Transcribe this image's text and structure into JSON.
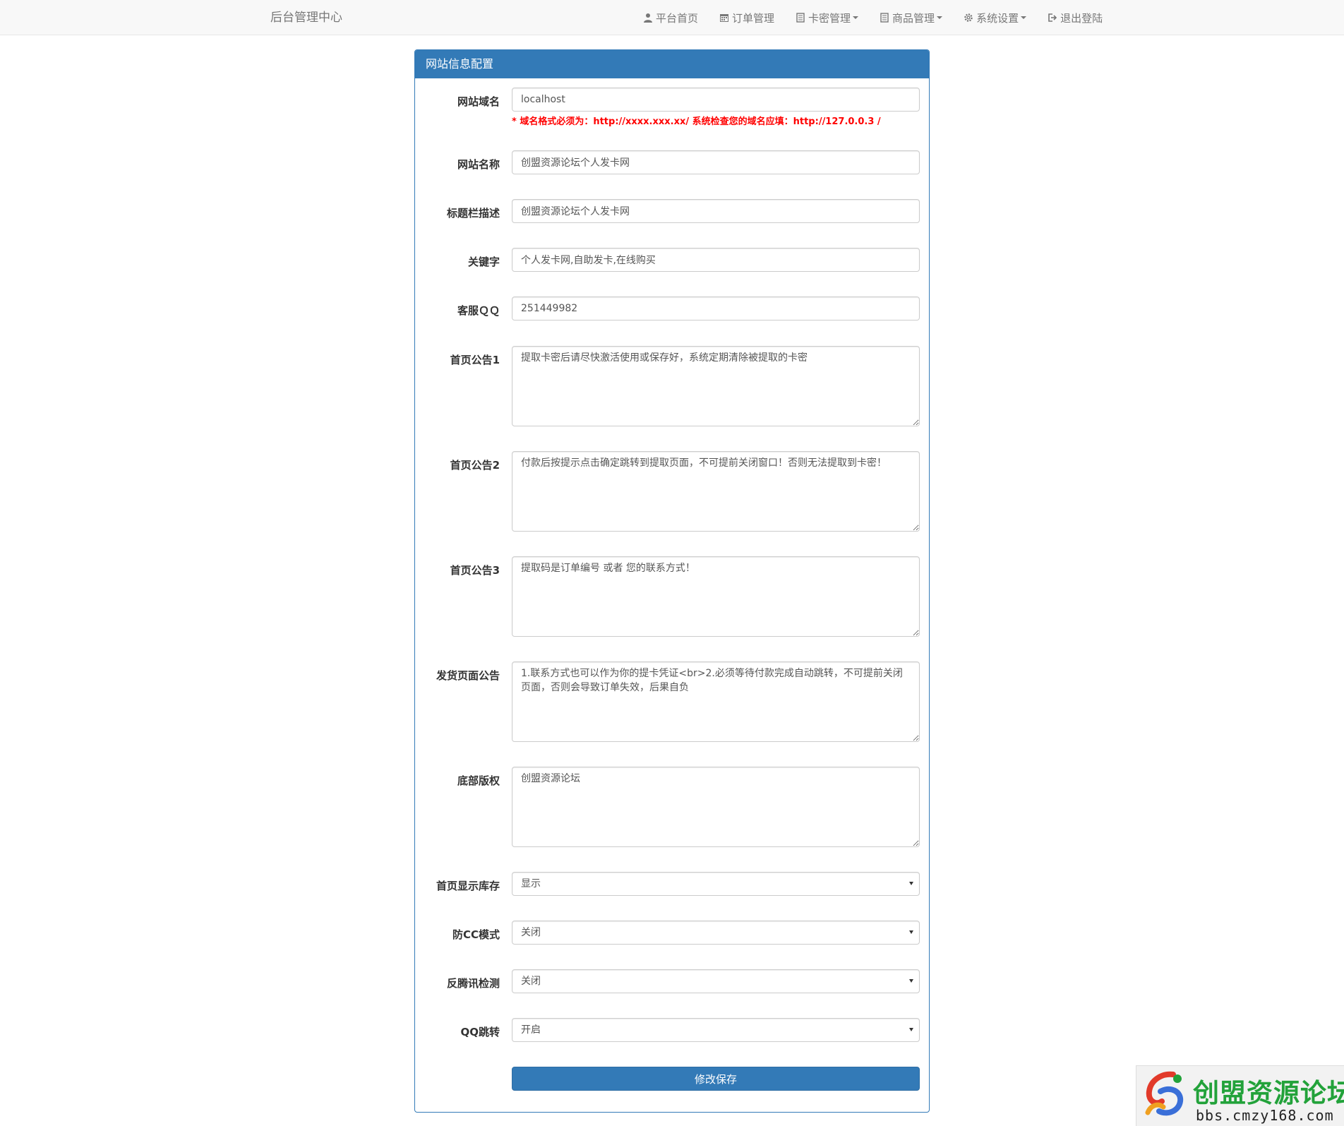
{
  "navbar": {
    "brand": "后台管理中心",
    "links": [
      {
        "label": "平台首页",
        "icon": "user-icon",
        "dropdown": false
      },
      {
        "label": "订单管理",
        "icon": "calendar-icon",
        "dropdown": false
      },
      {
        "label": "卡密管理",
        "icon": "list-icon",
        "dropdown": true
      },
      {
        "label": "商品管理",
        "icon": "list-icon",
        "dropdown": true
      },
      {
        "label": "系统设置",
        "icon": "gear-icon",
        "dropdown": true
      },
      {
        "label": "退出登陆",
        "icon": "logout-icon",
        "dropdown": false
      }
    ]
  },
  "panel": {
    "title": "网站信息配置",
    "fields": {
      "domain": {
        "label": "网站域名",
        "value": "localhost",
        "help": "* 域名格式必须为：http://xxxx.xxx.xx/ 系统检查您的域名应填：http://127.0.0.3 /"
      },
      "site_name": {
        "label": "网站名称",
        "value": "创盟资源论坛个人发卡网"
      },
      "title_desc": {
        "label": "标题栏描述",
        "value": "创盟资源论坛个人发卡网"
      },
      "keywords": {
        "label": "关键字",
        "value": "个人发卡网,自助发卡,在线购买"
      },
      "qq": {
        "label": "客服ＱＱ",
        "value": "251449982"
      },
      "notice1": {
        "label": "首页公告1",
        "value": "提取卡密后请尽快激活使用或保存好，系统定期清除被提取的卡密"
      },
      "notice2": {
        "label": "首页公告2",
        "value": "付款后按提示点击确定跳转到提取页面，不可提前关闭窗口！否则无法提取到卡密！"
      },
      "notice3": {
        "label": "首页公告3",
        "value": "提取码是订单编号 或者 您的联系方式！"
      },
      "delivery_notice": {
        "label": "发货页面公告",
        "value": "1.联系方式也可以作为你的提卡凭证<br>2.必须等待付款完成自动跳转，不可提前关闭页面，否则会导致订单失效，后果自负"
      },
      "copyright": {
        "label": "底部版权",
        "value": "创盟资源论坛"
      },
      "show_stock": {
        "label": "首页显示库存",
        "value": "显示"
      },
      "anti_cc": {
        "label": "防CC模式",
        "value": "关闭"
      },
      "anti_tencent": {
        "label": "反腾讯检测",
        "value": "关闭"
      },
      "qq_jump": {
        "label": "QQ跳转",
        "value": "开启"
      }
    },
    "save_label": "修改保存"
  },
  "watermark": {
    "title": "创盟资源论坛",
    "url": "bbs.cmzy168.com"
  },
  "colors": {
    "primary": "#337ab7",
    "navbar_bg": "#f8f8f8",
    "help_text": "#ff0000",
    "watermark_green": "#22a23a"
  }
}
